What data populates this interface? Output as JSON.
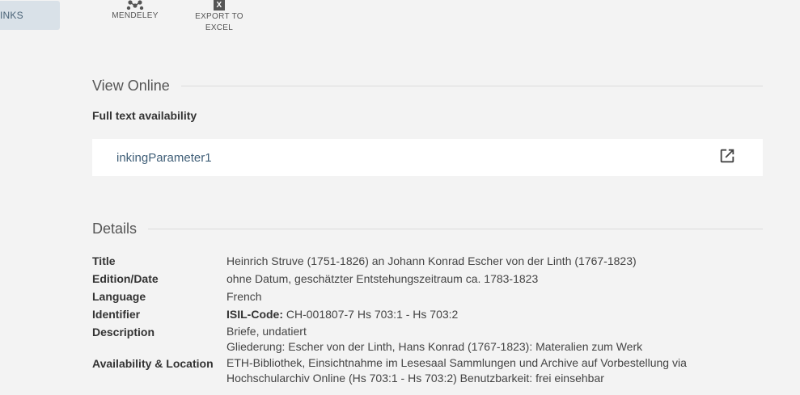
{
  "side_tab": {
    "label": "INKS"
  },
  "toolbar": {
    "mendeley_label": "MENDELEY",
    "export_label_line1": "EXPORT TO",
    "export_label_line2": "EXCEL",
    "export_icon_glyph": "X"
  },
  "view_online": {
    "title": "View Online",
    "subheading": "Full text availability",
    "link_text": "inkingParameter1"
  },
  "details": {
    "title": "Details",
    "rows": [
      {
        "label": "Title",
        "value": "Heinrich Struve (1751-1826) an Johann Konrad Escher von der Linth (1767-1823)"
      },
      {
        "label": "Edition/Date",
        "value": "ohne Datum, geschätzter Entstehungszeitraum ca. 1783-1823"
      },
      {
        "label": "Language",
        "value": "French"
      },
      {
        "label": "Identifier",
        "value_prefix": "ISIL-Code:",
        "value": "CH-001807-7 Hs 703:1 - Hs 703:2"
      },
      {
        "label": "Description",
        "value_lines": [
          "Briefe, undatiert",
          "Gliederung: Escher von der Linth, Hans Konrad (1767-1823): Materalien zum Werk"
        ]
      },
      {
        "label": "Availability & Location",
        "value_lines": [
          "ETH-Bibliothek, Einsichtnahme im Lesesaal Sammlungen und Archive auf Vorbestellung via",
          "Hochschularchiv Online (Hs 703:1 - Hs 703:2) Benutzbarkeit: frei einsehbar"
        ]
      }
    ]
  },
  "colors": {
    "background": "#f3f3f3",
    "link": "#3f5e77",
    "side_tab": "#d9e1e8"
  }
}
